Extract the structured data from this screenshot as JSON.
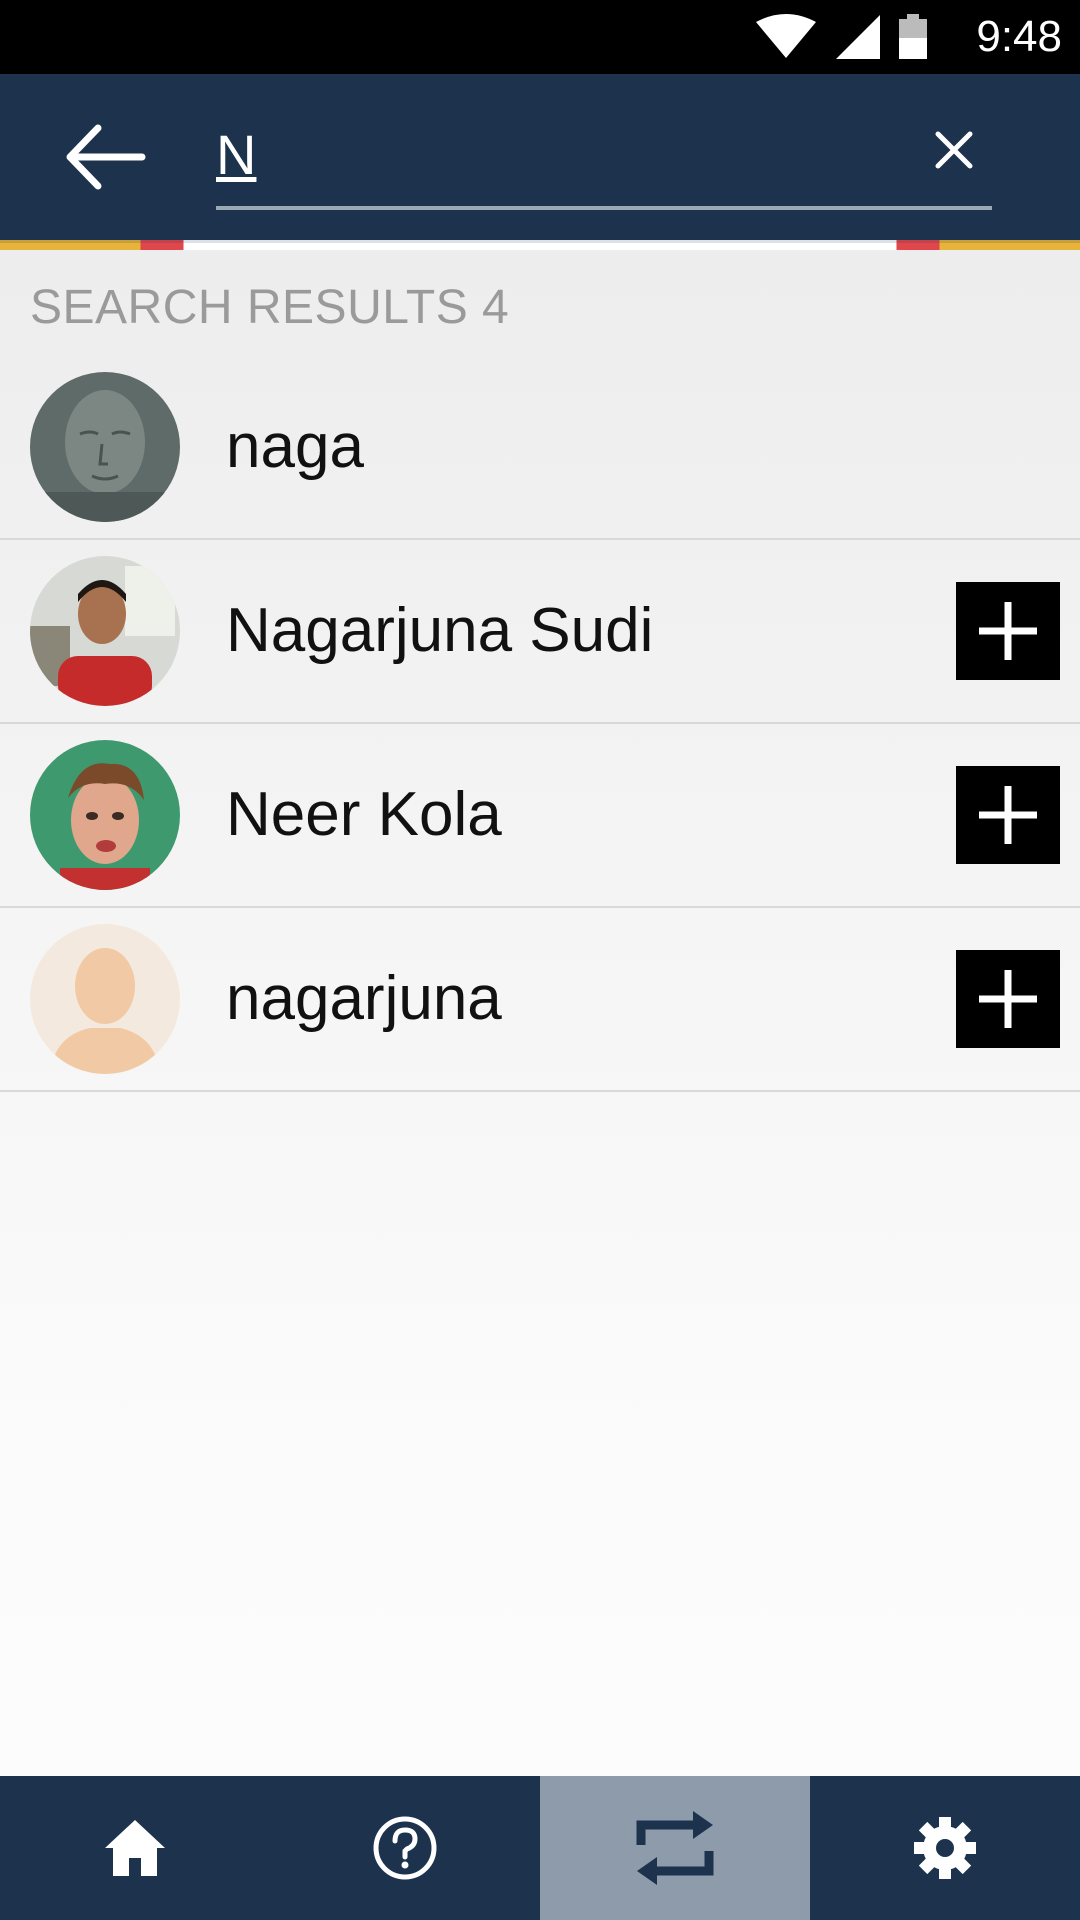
{
  "status_bar": {
    "time": "9:48"
  },
  "search": {
    "value": "N",
    "placeholder": ""
  },
  "results": {
    "header": "SEARCH RESULTS 4",
    "items": [
      {
        "name": "naga",
        "avatar": "statue-face-avatar",
        "has_add": false
      },
      {
        "name": "Nagarjuna Sudi",
        "avatar": "man-selfie-avatar",
        "has_add": true
      },
      {
        "name": "Neer Kola",
        "avatar": "boy-green-background-avatar",
        "has_add": true
      },
      {
        "name": "nagarjuna",
        "avatar": "default-person-avatar",
        "has_add": true
      }
    ]
  },
  "bottom_nav": {
    "items": [
      {
        "icon": "home-icon",
        "active": false
      },
      {
        "icon": "help-icon",
        "active": false
      },
      {
        "icon": "repeat-icon",
        "active": true
      },
      {
        "icon": "gear-icon",
        "active": false
      }
    ]
  },
  "colors": {
    "header_bg": "#1c324d",
    "nav_active_bg": "#8e9bab",
    "accent_yellow": "#e8b33a",
    "accent_red": "#e0474c"
  }
}
